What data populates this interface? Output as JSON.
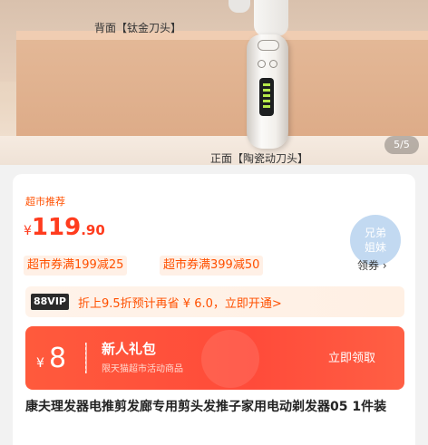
{
  "hero": {
    "back_label": "背面【钛金刀头】",
    "front_label": "正面【陶瓷动刀头】",
    "indicator": "5/5"
  },
  "product": {
    "section_tag": "超市推荐",
    "price_symbol": "¥",
    "price_integer": "119",
    "price_decimal": ".90",
    "coupons": [
      "超市券满199减25",
      "超市券满399减50"
    ],
    "coupon_link": "领券 ›",
    "bubble_text": "兄弟\n姐妹"
  },
  "vip": {
    "badge": "88VIP",
    "text": "折上9.5折预计再省 ¥ 6.0，立即开通>"
  },
  "gift": {
    "amount_symbol": "¥",
    "amount": "8",
    "title": "新人礼包",
    "subtitle": "限天猫超市活动商品",
    "button": "立即领取"
  },
  "title": "康夫理发器电推剪发廊专用剪头发推子家用电动剃发器05 1件装"
}
